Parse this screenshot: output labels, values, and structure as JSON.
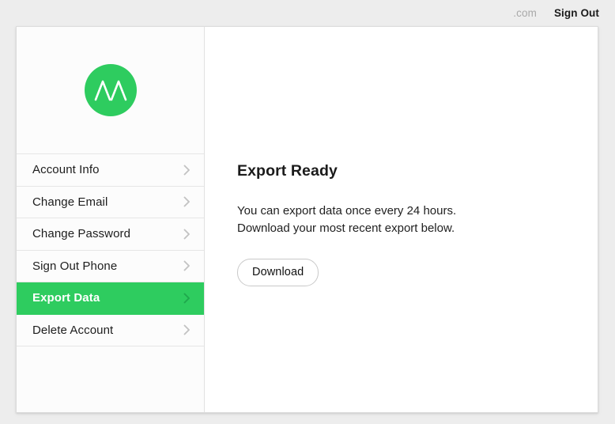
{
  "topbar": {
    "domain": ".com",
    "sign_out_label": "Sign Out"
  },
  "brand": {
    "logo_icon": "m-logo-icon",
    "logo_color": "#2ecc5f",
    "logo_mark_color": "#ffffff"
  },
  "sidebar": {
    "items": [
      {
        "label": "Account Info",
        "icon": "chevron-right-icon",
        "active": false
      },
      {
        "label": "Change Email",
        "icon": "chevron-right-icon",
        "active": false
      },
      {
        "label": "Change Password",
        "icon": "chevron-right-icon",
        "active": false
      },
      {
        "label": "Sign Out Phone",
        "icon": "chevron-right-icon",
        "active": false
      },
      {
        "label": "Export Data",
        "icon": "chevron-right-icon",
        "active": true
      },
      {
        "label": "Delete Account",
        "icon": "chevron-right-icon",
        "active": false
      }
    ],
    "active_bg": "#2ecc5f",
    "active_text": "#ffffff"
  },
  "main": {
    "title": "Export Ready",
    "body_line1": "You can export data once every 24 hours.",
    "body_line2": "Download your most recent export below.",
    "download_label": "Download"
  }
}
